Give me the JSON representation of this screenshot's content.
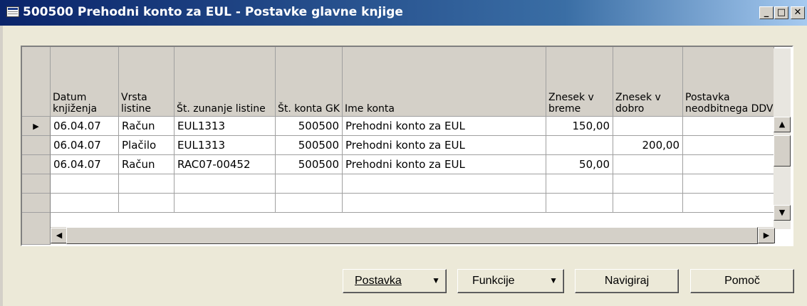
{
  "window": {
    "title": "500500 Prehodni konto za EUL - Postavke glavne knjige",
    "buttons": {
      "minimize": "_",
      "maximize": "□",
      "close": "✕"
    }
  },
  "table": {
    "columns": [
      "Datum knjiženja",
      "Vrsta listine",
      "Št. zunanje listine",
      "Št. konta GK",
      "Ime konta",
      "Znesek v breme",
      "Znesek v dobro",
      "Postavka neodbitnega DDV"
    ],
    "rows": [
      [
        "06.04.07",
        "Račun",
        "EUL1313",
        "500500",
        "Prehodni konto za EUL",
        "150,00",
        "",
        ""
      ],
      [
        "06.04.07",
        "Plačilo",
        "EUL1313",
        "500500",
        "Prehodni konto za EUL",
        "",
        "200,00",
        ""
      ],
      [
        "06.04.07",
        "Račun",
        "RAC07-00452",
        "500500",
        "Prehodni konto za EUL",
        "50,00",
        "",
        ""
      ],
      [
        "",
        "",
        "",
        "",
        "",
        "",
        "",
        ""
      ],
      [
        "",
        "",
        "",
        "",
        "",
        "",
        "",
        ""
      ]
    ],
    "selected_row_marker": "▶"
  },
  "scroll": {
    "up": "▲",
    "down": "▼",
    "left": "◀",
    "right": "▶"
  },
  "buttons": {
    "postavka": "Postavka",
    "funkcije": "Funkcije",
    "navigiraj": "Navigiraj",
    "pomoc": "Pomoč",
    "dropdown_arrow": "▼"
  },
  "colors": {
    "title_start": "#0a246a",
    "title_end": "#a6caf0",
    "chrome": "#ece9d8",
    "grid_header": "#d4d0c8"
  }
}
